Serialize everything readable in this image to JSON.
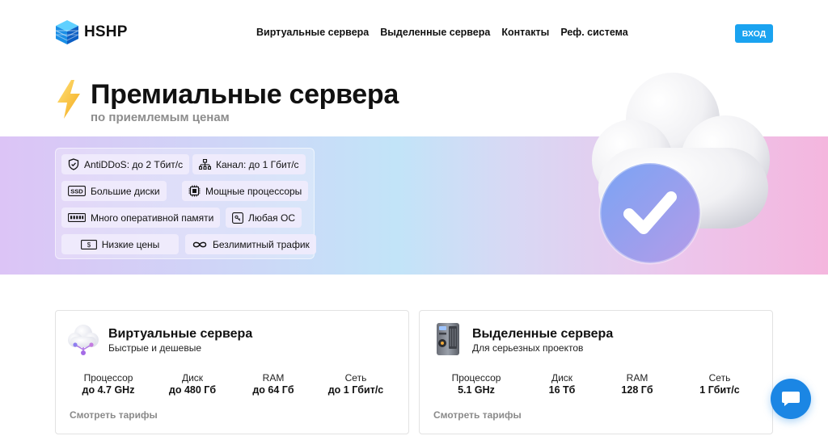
{
  "header": {
    "brand": "HSHP",
    "nav": [
      {
        "label": "Виртуальные сервера"
      },
      {
        "label": "Выделенные сервера"
      },
      {
        "label": "Контакты"
      },
      {
        "label": "Реф. система"
      }
    ],
    "login_label": "ВХОД"
  },
  "hero": {
    "title": "Премиальные сервера",
    "subtitle": "по приемлемым ценам",
    "features": [
      {
        "icon": "shield-icon",
        "label": "AntiDDoS: до 2 Тбит/с"
      },
      {
        "icon": "network-icon",
        "label": "Канал: до 1 Гбит/с"
      },
      {
        "icon": "ssd-icon",
        "label": "Большие диски"
      },
      {
        "icon": "cpu-icon",
        "label": "Мощные процессоры"
      },
      {
        "icon": "ram-icon",
        "label": "Много оперативной памяти"
      },
      {
        "icon": "os-icon",
        "label": "Любая ОС"
      },
      {
        "icon": "dollar-icon",
        "label": "Низкие цены"
      },
      {
        "icon": "infinity-icon",
        "label": "Безлимитный трафик"
      }
    ],
    "ssd_badge": "SSD"
  },
  "cards": [
    {
      "title": "Виртуальные сервера",
      "subtitle": "Быстрые и дешевые",
      "specs": [
        {
          "label": "Процессор",
          "value": "до 4.7 GHz"
        },
        {
          "label": "Диск",
          "value": "до 480 Гб"
        },
        {
          "label": "RAM",
          "value": "до 64 Гб"
        },
        {
          "label": "Сеть",
          "value": "до 1 Гбит/с"
        }
      ],
      "link": "Смотреть тарифы"
    },
    {
      "title": "Выделенные сервера",
      "subtitle": "Для серьезных проектов",
      "specs": [
        {
          "label": "Процессор",
          "value": "5.1 GHz"
        },
        {
          "label": "Диск",
          "value": "16 Тб"
        },
        {
          "label": "RAM",
          "value": "128 Гб"
        },
        {
          "label": "Сеть",
          "value": "1 Гбит/с"
        }
      ],
      "link": "Смотреть тарифы"
    }
  ],
  "colors": {
    "accent": "#1aa3f0",
    "chat": "#1b86e4"
  }
}
